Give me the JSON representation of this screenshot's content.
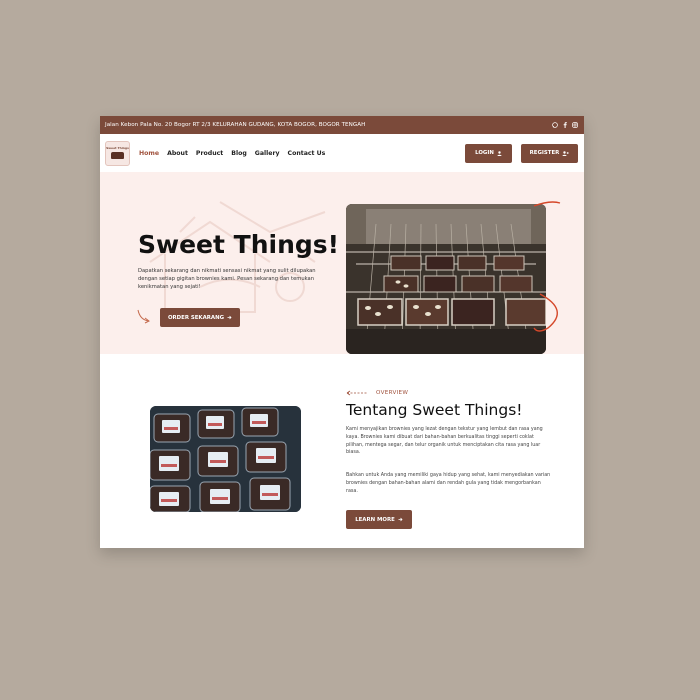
{
  "topbar": {
    "address": "Jalan Kebon Pala No. 20 Bogor RT 2/3 KELURAHAN GUDANG, KOTA BOGOR, BOGOR TENGAH",
    "social_icons": [
      "whatsapp-icon",
      "facebook-icon",
      "instagram-icon"
    ]
  },
  "nav": {
    "logo_text": "Sweet Things",
    "menu": [
      "Home",
      "About",
      "Product",
      "Blog",
      "Gallery",
      "Contact Us"
    ],
    "login_label": "LOGIN",
    "register_label": "REGISTER"
  },
  "hero": {
    "title": "Sweet Things!",
    "description": "Dapatkan sekarang dan nikmati sensasi nikmat yang sulit dilupakan dengan setiap gigitan brownies kami. Pesan sekarang dan temukan kenikmatan yang sejati!",
    "cta_label": "ORDER SEKARANG"
  },
  "about": {
    "eyebrow": "OVERVIEW",
    "title": "Tentang Sweet Things!",
    "paragraph1": "Kami menyajikan brownies yang lezat dengan tekstur yang lembut dan rasa yang kaya. Brownies kami dibuat dari bahan-bahan berkualitas tinggi seperti coklat pilihan, mentega segar, dan telur organik untuk menciptakan cita rasa yang luar biasa.",
    "paragraph2": "Bahkan untuk Anda yang memiliki gaya hidup yang sehat, kami menyediakan varian brownies dengan bahan-bahan alami dan rendah gula yang tidak mengorbankan rasa.",
    "cta_label": "LEARN MORE"
  },
  "colors": {
    "brand": "#7b4a3a",
    "accent": "#a0523d",
    "hero_bg": "#fcefec",
    "backdrop": "#b5aa9e",
    "swoosh": "#d5482a"
  }
}
